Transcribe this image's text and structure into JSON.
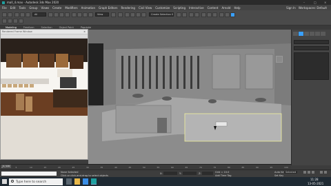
{
  "window": {
    "title": "mall_4.max - Autodesk 3ds Max 2020"
  },
  "menu": {
    "items": [
      "File",
      "Edit",
      "Tools",
      "Group",
      "Views",
      "Create",
      "Modifiers",
      "Animation",
      "Graph Editors",
      "Rendering",
      "Civil View",
      "Customize",
      "Scripting",
      "Interactive",
      "Content",
      "Arnold",
      "Help"
    ],
    "user": "Sign In",
    "workspace": "Workspaces: Default"
  },
  "toolbar": {
    "selection_set": "Create Selection Set",
    "view_dropdown": "View",
    "filter_dropdown": "All"
  },
  "ribbon": {
    "tabs": [
      "Modeling",
      "Freeform",
      "Selection",
      "Object Paint",
      "Populate"
    ]
  },
  "render_window": {
    "title": "Rendered Frame Window"
  },
  "timeline": {
    "frame_counter": "0 / 100",
    "ticks": [
      "0",
      "5",
      "10",
      "15",
      "20",
      "25",
      "30",
      "35",
      "40",
      "45",
      "50",
      "55",
      "60",
      "65",
      "70",
      "75",
      "80",
      "85",
      "90",
      "95",
      "100"
    ]
  },
  "status": {
    "selection": "None Selected",
    "prompt": "Click or click-and-drag to select objects",
    "x_label": "X:",
    "y_label": "Y:",
    "z_label": "Z:",
    "grid": "Grid = 10.0",
    "add_time_tag": "Add Time Tag",
    "auto_key": "Auto Key",
    "set_key": "Set Key",
    "key_filter": "Selected"
  },
  "taskbar": {
    "search_placeholder": "Type here to search",
    "time": "11:28",
    "date": "13-05-2021"
  },
  "colors": {
    "accent": "#3aa0ff",
    "selection": "#f0f09a",
    "taskbar": "#1f2a33"
  }
}
